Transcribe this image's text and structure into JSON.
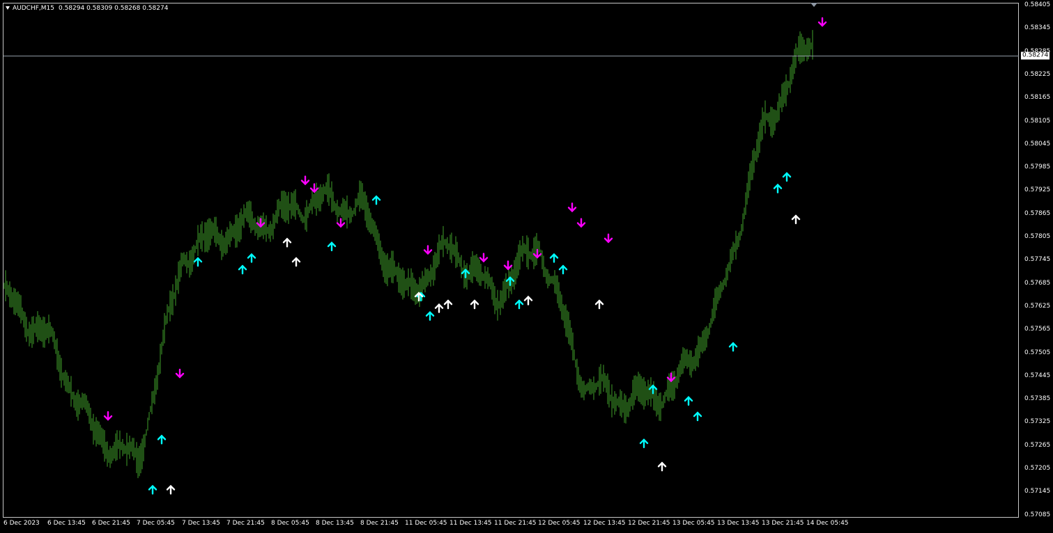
{
  "header": {
    "symbol_timeframe": "AUDCHF,M15",
    "ohlc": "0.58294 0.58309 0.58268 0.58274"
  },
  "current_price": "0.58274",
  "colors": {
    "background": "#000000",
    "candles": "#3fa02a",
    "up_arrow": "#00ffff",
    "down_arrow": "#ff00ff",
    "white_arrow": "#ffffff",
    "price_line": "#8e98a4"
  },
  "y_axis": {
    "ticks": [
      "0.58405",
      "0.58345",
      "0.58285",
      "0.58225",
      "0.58165",
      "0.58105",
      "0.58045",
      "0.57985",
      "0.57925",
      "0.57865",
      "0.57805",
      "0.57745",
      "0.57685",
      "0.57625",
      "0.57565",
      "0.57505",
      "0.57445",
      "0.57385",
      "0.57325",
      "0.57265",
      "0.57205",
      "0.57145",
      "0.57085"
    ]
  },
  "x_axis": {
    "ticks": [
      "6 Dec 2023",
      "6 Dec 13:45",
      "6 Dec 21:45",
      "7 Dec 05:45",
      "7 Dec 13:45",
      "7 Dec 21:45",
      "8 Dec 05:45",
      "8 Dec 13:45",
      "8 Dec 21:45",
      "11 Dec 05:45",
      "11 Dec 13:45",
      "11 Dec 21:45",
      "12 Dec 05:45",
      "12 Dec 13:45",
      "12 Dec 21:45",
      "13 Dec 05:45",
      "13 Dec 13:45",
      "13 Dec 21:45",
      "14 Dec 05:45"
    ]
  },
  "chart_data": {
    "type": "line",
    "symbol": "AUDCHF",
    "timeframe": "M15",
    "ylim": [
      0.5706,
      0.5842
    ],
    "series": [
      {
        "name": "AUDCHF",
        "x": [
          "6 Dec 2023",
          "6 Dec 13:45",
          "6 Dec 21:45",
          "7 Dec 05:45",
          "7 Dec 13:45",
          "7 Dec 21:45",
          "8 Dec 05:45",
          "8 Dec 13:45",
          "8 Dec 21:45",
          "11 Dec 05:45",
          "11 Dec 13:45",
          "11 Dec 21:45",
          "12 Dec 05:45",
          "12 Dec 13:45",
          "12 Dec 21:45",
          "13 Dec 05:45",
          "13 Dec 13:45",
          "13 Dec 21:45",
          "14 Dec 05:45"
        ],
        "values": [
          0.5765,
          0.5754,
          0.573,
          0.5722,
          0.5776,
          0.5782,
          0.5785,
          0.579,
          0.5788,
          0.5765,
          0.5778,
          0.5765,
          0.5779,
          0.5742,
          0.5738,
          0.5741,
          0.5762,
          0.5808,
          0.583
        ]
      }
    ],
    "signals_up_cyan": [
      {
        "x": "7 Dec 05:45",
        "y": 0.5715
      },
      {
        "x": "7 Dec 05:45",
        "y": 0.5728
      },
      {
        "x": "7 Dec 13:45",
        "y": 0.5774
      },
      {
        "x": "7 Dec 21:45",
        "y": 0.5772
      },
      {
        "x": "7 Dec 21:45",
        "y": 0.5775
      },
      {
        "x": "8 Dec 13:45",
        "y": 0.5778
      },
      {
        "x": "8 Dec 21:45",
        "y": 0.579
      },
      {
        "x": "11 Dec 05:45",
        "y": 0.5765
      },
      {
        "x": "11 Dec 05:45",
        "y": 0.576
      },
      {
        "x": "11 Dec 13:45",
        "y": 0.5771
      },
      {
        "x": "11 Dec 21:45",
        "y": 0.5769
      },
      {
        "x": "11 Dec 21:45",
        "y": 0.5763
      },
      {
        "x": "12 Dec 05:45",
        "y": 0.5775
      },
      {
        "x": "12 Dec 05:45",
        "y": 0.5772
      },
      {
        "x": "12 Dec 21:45",
        "y": 0.5727
      },
      {
        "x": "12 Dec 21:45",
        "y": 0.5741
      },
      {
        "x": "13 Dec 05:45",
        "y": 0.5738
      },
      {
        "x": "13 Dec 05:45",
        "y": 0.5734
      },
      {
        "x": "13 Dec 13:45",
        "y": 0.5752
      },
      {
        "x": "13 Dec 21:45",
        "y": 0.5793
      },
      {
        "x": "13 Dec 21:45",
        "y": 0.5796
      }
    ],
    "signals_up_white": [
      {
        "x": "7 Dec 05:45",
        "y": 0.5715
      },
      {
        "x": "8 Dec 05:45",
        "y": 0.5779
      },
      {
        "x": "8 Dec 05:45",
        "y": 0.5774
      },
      {
        "x": "11 Dec 05:45",
        "y": 0.5762
      },
      {
        "x": "11 Dec 05:45",
        "y": 0.5763
      },
      {
        "x": "11 Dec 05:45",
        "y": 0.5765
      },
      {
        "x": "11 Dec 13:45",
        "y": 0.5763
      },
      {
        "x": "11 Dec 21:45",
        "y": 0.5764
      },
      {
        "x": "12 Dec 13:45",
        "y": 0.5763
      },
      {
        "x": "12 Dec 21:45",
        "y": 0.5721
      },
      {
        "x": "13 Dec 21:45",
        "y": 0.5785
      }
    ],
    "signals_down_magenta": [
      {
        "x": "6 Dec 21:45",
        "y": 0.5734
      },
      {
        "x": "7 Dec 05:45",
        "y": 0.5745
      },
      {
        "x": "7 Dec 21:45",
        "y": 0.5784
      },
      {
        "x": "8 Dec 05:45",
        "y": 0.5795
      },
      {
        "x": "8 Dec 05:45",
        "y": 0.5793
      },
      {
        "x": "8 Dec 13:45",
        "y": 0.5784
      },
      {
        "x": "11 Dec 05:45",
        "y": 0.5777
      },
      {
        "x": "11 Dec 13:45",
        "y": 0.5775
      },
      {
        "x": "11 Dec 21:45",
        "y": 0.5776
      },
      {
        "x": "11 Dec 21:45",
        "y": 0.5773
      },
      {
        "x": "12 Dec 05:45",
        "y": 0.5788
      },
      {
        "x": "12 Dec 05:45",
        "y": 0.5784
      },
      {
        "x": "12 Dec 13:45",
        "y": 0.578
      },
      {
        "x": "12 Dec 21:45",
        "y": 0.5744
      },
      {
        "x": "14 Dec 05:45",
        "y": 0.5836
      }
    ]
  }
}
